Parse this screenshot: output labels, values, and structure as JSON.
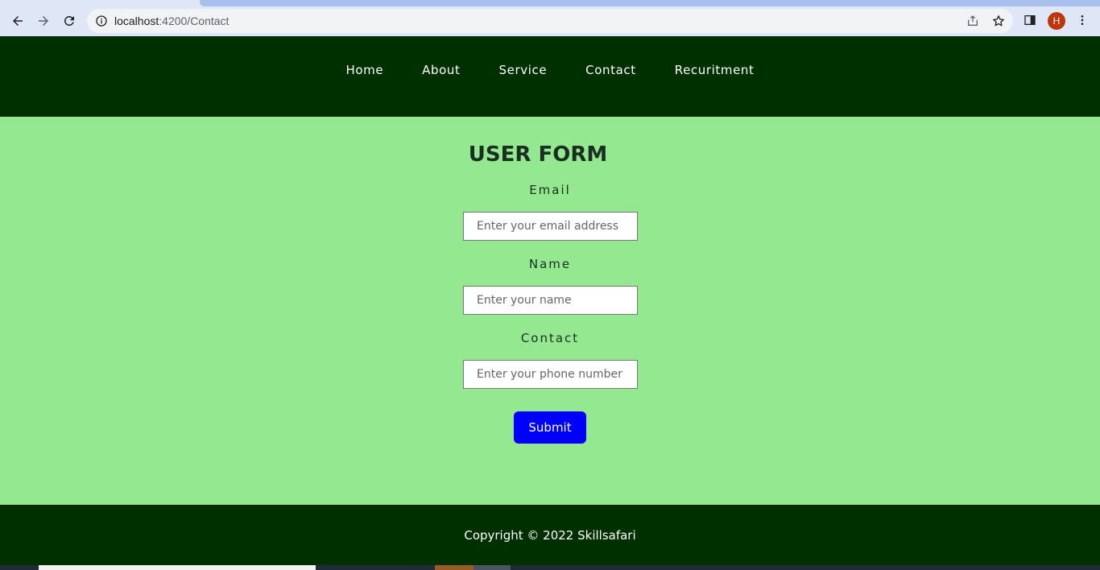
{
  "browser": {
    "url_host": "localhost",
    "url_path": ":4200/Contact",
    "profile_initial": "H"
  },
  "nav": {
    "items": [
      "Home",
      "About",
      "Service",
      "Contact",
      "Recuritment"
    ]
  },
  "form": {
    "title": "USER FORM",
    "email_label": "Email",
    "email_placeholder": "Enter your email address",
    "name_label": "Name",
    "name_placeholder": "Enter your name",
    "contact_label": "Contact",
    "contact_placeholder": "Enter your phone number",
    "submit_label": "Submit"
  },
  "footer": {
    "text": "Copyright © 2022 Skillsafari"
  },
  "colors": {
    "nav_bg": "#003000",
    "main_bg": "#93e890",
    "submit_bg": "#0000ff"
  }
}
